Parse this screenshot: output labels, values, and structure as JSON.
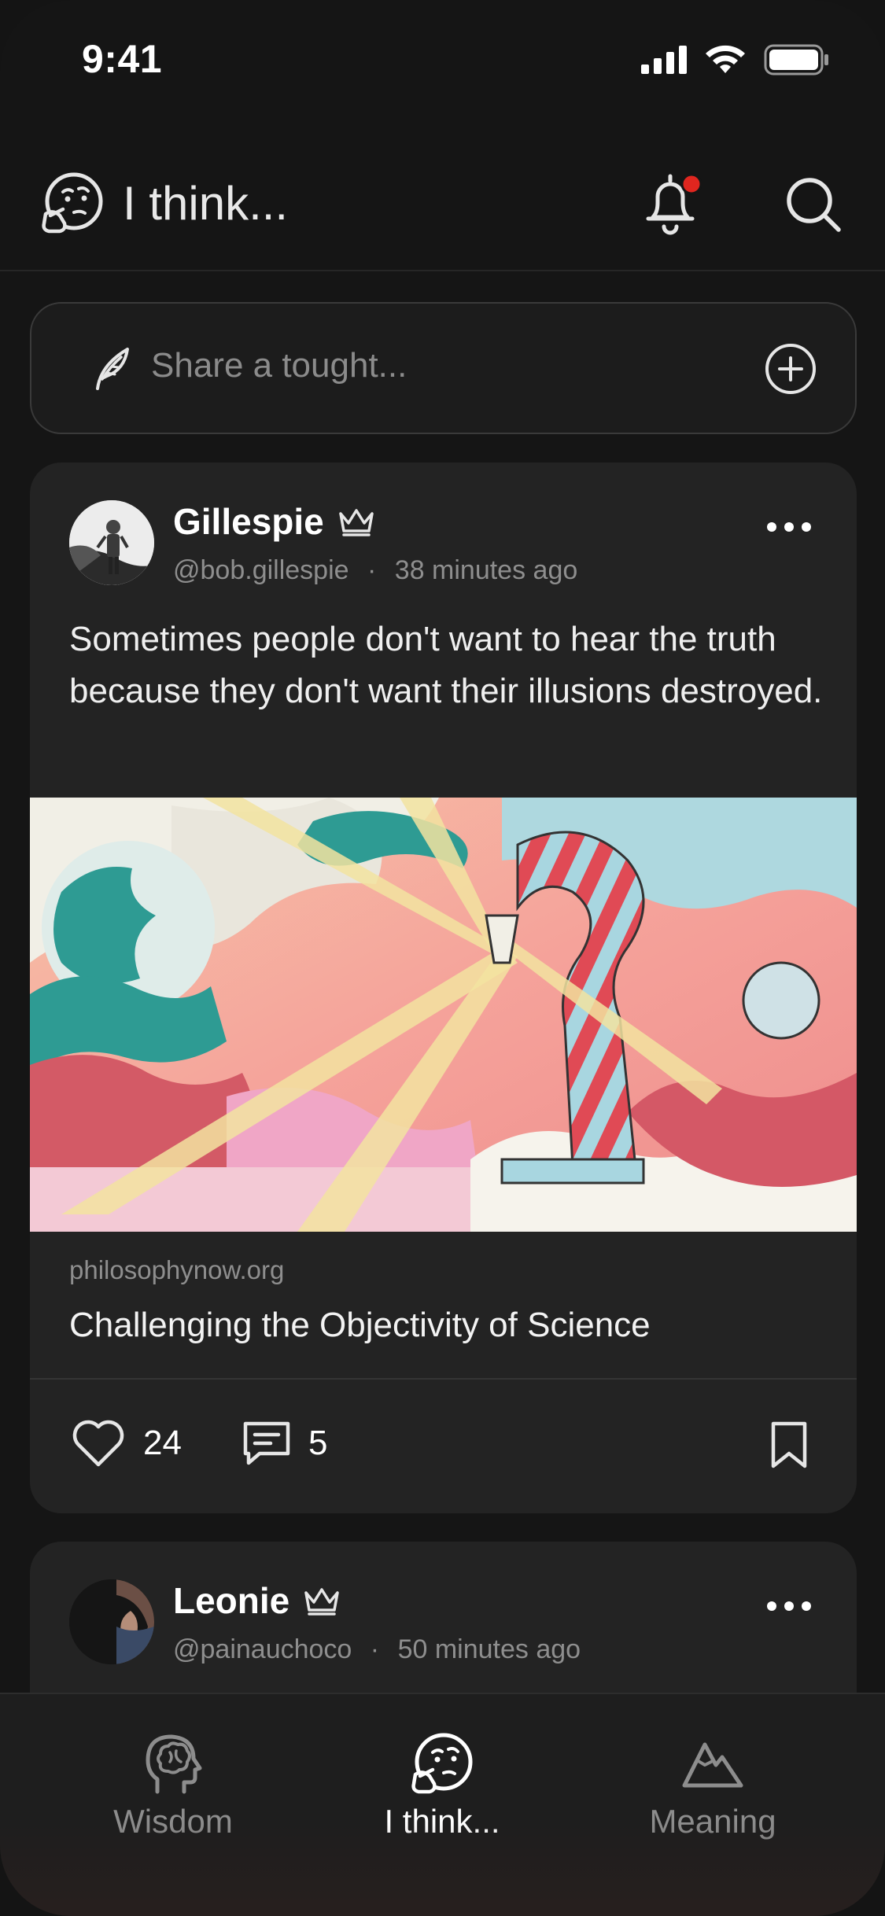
{
  "status_bar": {
    "time": "9:41"
  },
  "header": {
    "title": "I think...",
    "notification_dot_color": "#e0261f"
  },
  "compose": {
    "placeholder": "Share a tought..."
  },
  "posts": [
    {
      "author": "Gillespie",
      "handle": "@bob.gillespie",
      "separator": "·",
      "time_ago": "38 minutes ago",
      "text": "Sometimes people don't want to hear the truth because they don't want their illusions destroyed.",
      "link_domain": "philosophynow.org",
      "link_title": "Challenging the Objectivity of Science",
      "likes": "24",
      "comments": "5"
    },
    {
      "author": "Leonie",
      "handle": "@painauchoco",
      "separator": "·",
      "time_ago": "50 minutes ago"
    }
  ],
  "tabs": [
    {
      "label": "Wisdom",
      "icon": "brain-head-icon",
      "active": false
    },
    {
      "label": "I think...",
      "icon": "thinking-face-icon",
      "active": true
    },
    {
      "label": "Meaning",
      "icon": "mountain-icon",
      "active": false
    }
  ],
  "colors": {
    "background": "#151515",
    "card": "#232323",
    "accent_dot": "#e0261f"
  }
}
